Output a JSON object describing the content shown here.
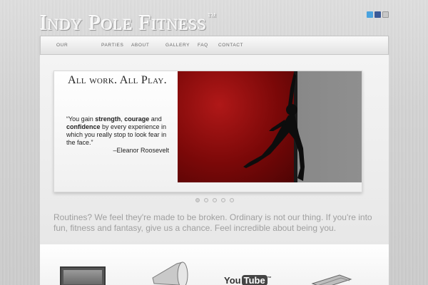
{
  "site": {
    "logo_text": "Indy Pole Fitness",
    "logo_tm": "TM"
  },
  "social": {
    "icons": [
      "twitter-icon",
      "facebook-icon",
      "mail-icon"
    ]
  },
  "nav": {
    "items": [
      "OUR",
      "PARTIES",
      "ABOUT",
      "GALLERY",
      "FAQ",
      "CONTACT"
    ]
  },
  "slider": {
    "headline": "All work. All Play.",
    "quote_parts": {
      "p1": "“You gain ",
      "strength": "strength",
      "p2": ", ",
      "courage": "courage",
      "p3": " and ",
      "confidence": "confidence",
      "p4": " by every experience in which you really stop to look fear in the face.”"
    },
    "author": "–Eleanor Roosevelt",
    "dot_count": 5,
    "active_dot": 0
  },
  "tagline": "Routines? We feel they're made to be broken. Ordinary is not our thing. If you're into fun, fitness and fantasy, give us a chance. Feel incredible about being you.",
  "bottom_icons": {
    "youtube_you": "You",
    "youtube_tube": "Tube",
    "youtube_tm": "™"
  },
  "colors": {
    "slide_red": "#8a0c0c",
    "tagline": "#a0a0a0",
    "twitter": "#4aa3df",
    "facebook": "#3b5a98"
  }
}
